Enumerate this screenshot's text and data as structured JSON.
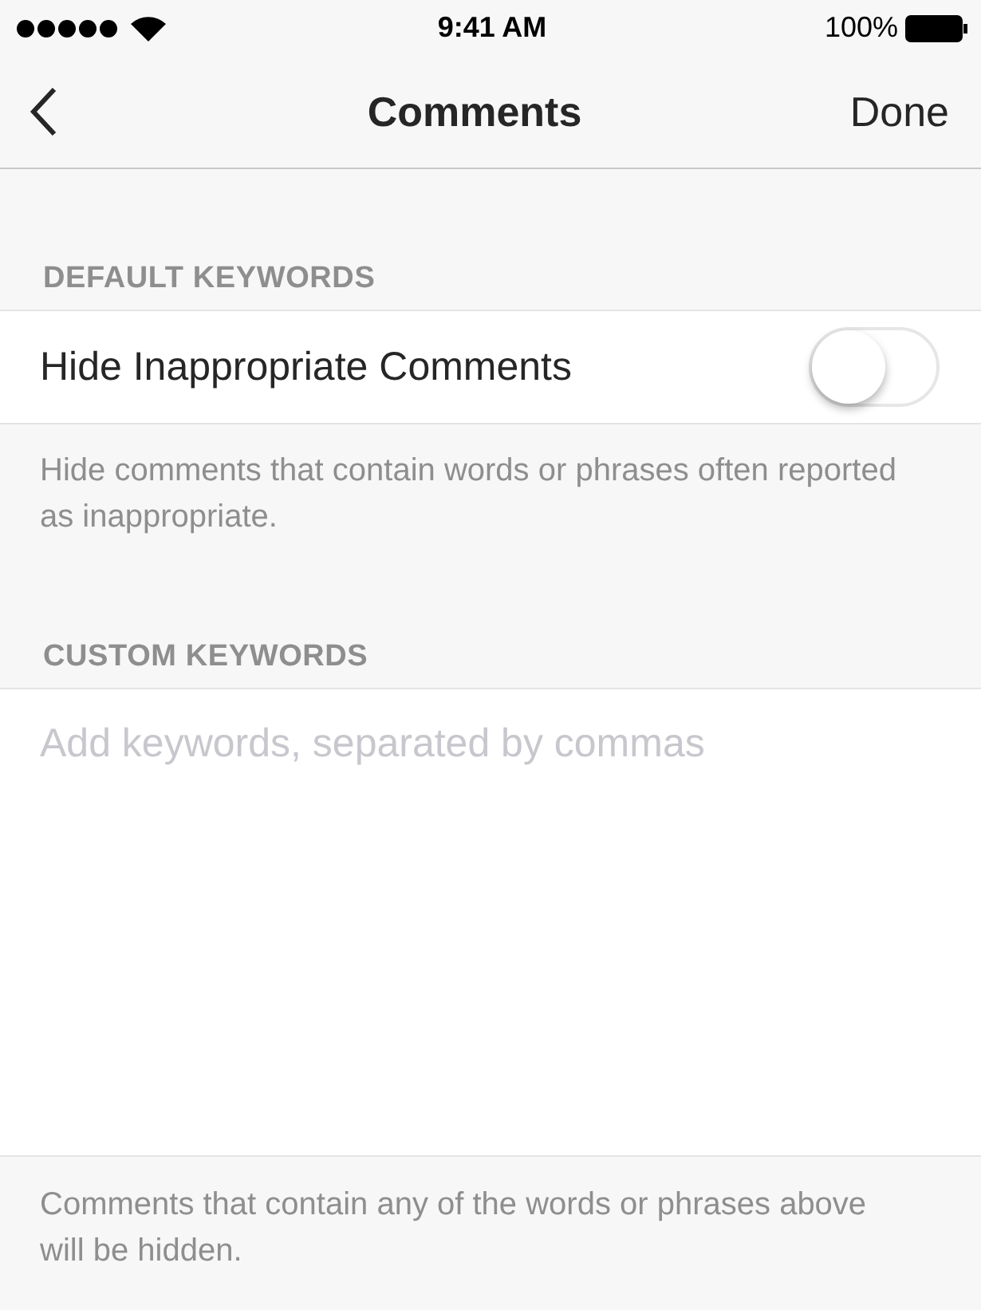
{
  "status_bar": {
    "time": "9:41 AM",
    "battery": "100%"
  },
  "nav_bar": {
    "title": "Comments",
    "action": "Done"
  },
  "default_section": {
    "header": "DEFAULT KEYWORDS",
    "toggle": {
      "label": "Hide Inappropriate Comments",
      "on": false
    },
    "footer": "Hide comments that contain words or phrases often reported as inappropriate."
  },
  "custom_section": {
    "header": "CUSTOM KEYWORDS",
    "field": {
      "placeholder": "Add keywords, separated by commas"
    },
    "footer": "Comments that contain any of the words or phrases above will be hidden."
  }
}
